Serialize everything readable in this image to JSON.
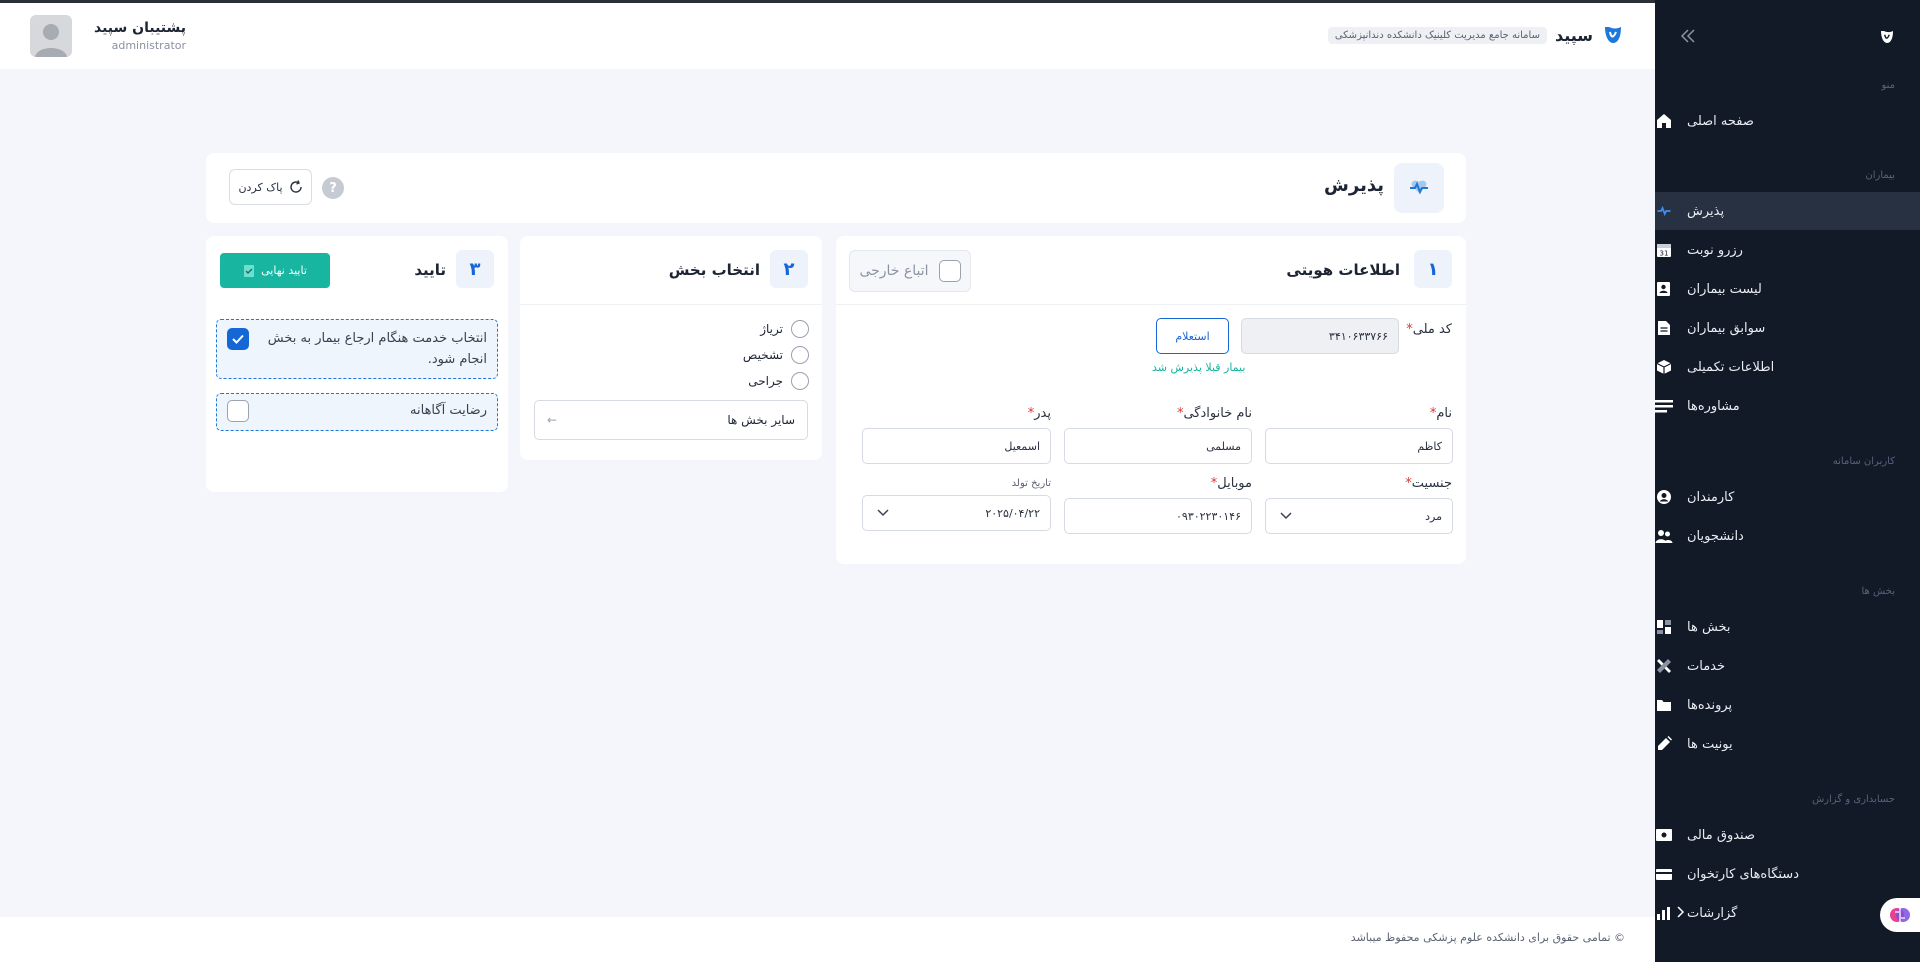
{
  "header": {
    "brand_name": "سپید",
    "brand_subtitle": "سامانه جامع مدیریت کلینیک دانشکده دندانپزشکی",
    "user_name": "پشتیبان سپید",
    "user_role": "administrator"
  },
  "sidebar": {
    "sections": [
      {
        "label": "منو"
      },
      {
        "label": "بیماران"
      },
      {
        "label": "کاربران سامانه"
      },
      {
        "label": "بخش ها"
      },
      {
        "label": "حسابداری و گزارش"
      }
    ],
    "items": [
      {
        "label": "صفحه اصلی",
        "icon": "home-icon"
      },
      {
        "label": "پذیرش",
        "icon": "heartbeat-icon",
        "active": true
      },
      {
        "label": "رزرو نوبت",
        "icon": "calendar-icon"
      },
      {
        "label": "لیست بیماران",
        "icon": "contacts-icon"
      },
      {
        "label": "سوابق بیماران",
        "icon": "document-icon"
      },
      {
        "label": "اطلاعات تکمیلی",
        "icon": "cube-icon"
      },
      {
        "label": "مشاوره‌ها",
        "icon": "lines-icon"
      },
      {
        "label": "کارمندان",
        "icon": "user-circle-icon"
      },
      {
        "label": "دانشجویان",
        "icon": "users-icon"
      },
      {
        "label": "بخش ها",
        "icon": "dashboard-icon"
      },
      {
        "label": "خدمات",
        "icon": "tools-icon"
      },
      {
        "label": "پرونده‌ها",
        "icon": "folder-icon"
      },
      {
        "label": "یونیت ها",
        "icon": "syringe-icon"
      },
      {
        "label": "صندوق مالی",
        "icon": "cash-icon"
      },
      {
        "label": "دستگاه‌های کارتخوان",
        "icon": "card-icon"
      },
      {
        "label": "گزارشات",
        "icon": "chart-icon"
      }
    ]
  },
  "page": {
    "title": "پذیرش",
    "clear_label": "پاک کردن",
    "help_label": "?"
  },
  "identity": {
    "step": "۱",
    "title": "اطلاعات هویتی",
    "foreign_label": "اتباع خارجی",
    "national_code_label": "کد ملی",
    "national_code_value": "۳۴۱۰۶۳۳۷۶۶",
    "inquiry_label": "استعلام",
    "already_admitted": "بیمار قبلا پذیرش شد",
    "first_name_label": "نام",
    "first_name_value": "کاظم",
    "last_name_label": "نام خانوادگی",
    "last_name_value": "مسلمی",
    "father_label": "پدر",
    "father_value": "اسمعیل",
    "gender_label": "جنسیت",
    "gender_value": "مرد",
    "mobile_label": "موبایل",
    "mobile_value": "۰۹۳۰۲۲۳۰۱۴۶",
    "birth_label": "تاریخ تولد",
    "birth_value": "۲۰۲۵/۰۴/۲۲",
    "required_mark": "*"
  },
  "section_select": {
    "step": "۲",
    "title": "انتخاب بخش",
    "options": [
      "تریاژ",
      "تشخیص",
      "جراحی"
    ],
    "other_label": "سایر بخش ها"
  },
  "confirm": {
    "step": "۳",
    "title": "تایید",
    "final_button": "تایید نهایی",
    "option1": "انتخاب خدمت هنگام ارجاع بیمار به بخش انجام شود.",
    "option1_checked": true,
    "option2": "رضایت آگاهانه",
    "option2_checked": false
  },
  "footer": {
    "text": "© تمامی حقوق برای دانشکده علوم پزشکی محفوظ میباشد"
  },
  "colors": {
    "primary": "#1567d6",
    "success": "#18b6a1",
    "sidebar_bg": "#121a27",
    "required": "#e0342f"
  }
}
